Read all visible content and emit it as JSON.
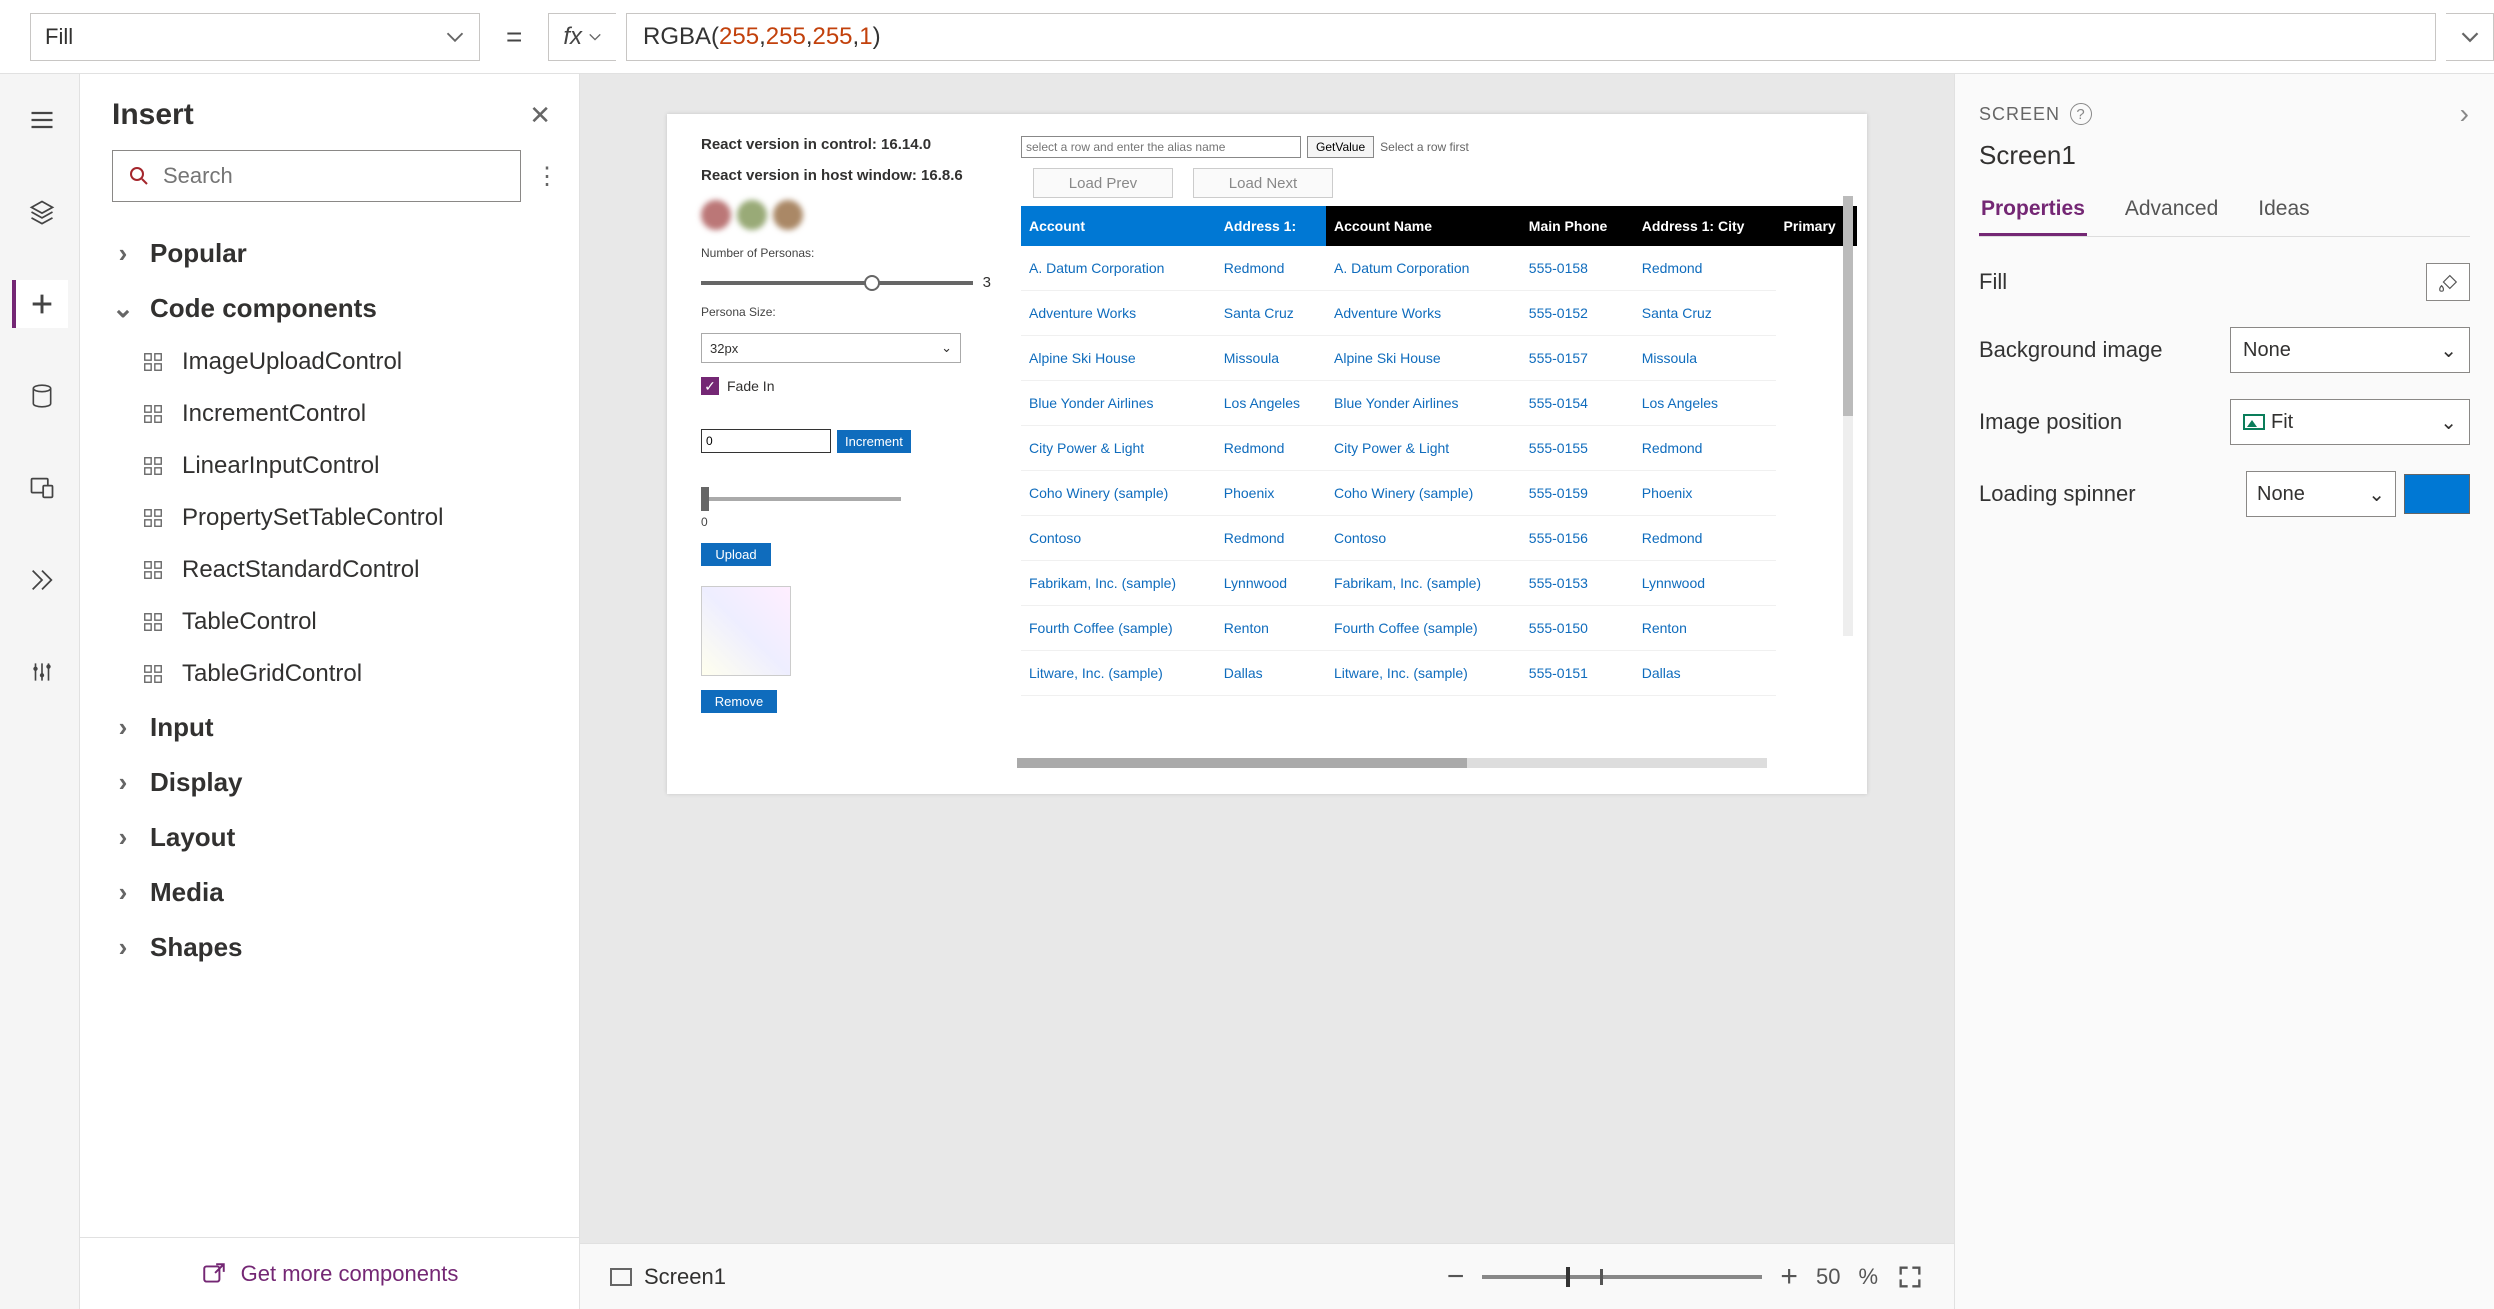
{
  "formula_bar": {
    "property": "Fill",
    "equals": "=",
    "fx_label": "fx",
    "formula_fn": "RGBA",
    "formula_args": [
      "255",
      "255",
      "255",
      "1"
    ]
  },
  "insert_panel": {
    "title": "Insert",
    "search_placeholder": "Search",
    "groups": {
      "popular": "Popular",
      "code_components": "Code components",
      "input": "Input",
      "display": "Display",
      "layout": "Layout",
      "media": "Media",
      "shapes": "Shapes"
    },
    "code_components_items": [
      "ImageUploadControl",
      "IncrementControl",
      "LinearInputControl",
      "PropertySetTableControl",
      "ReactStandardControl",
      "TableControl",
      "TableGridControl"
    ],
    "footer": "Get more components"
  },
  "canvas": {
    "left": {
      "react_control": "React version in control: 16.14.0",
      "react_host": "React version in host window: 16.8.6",
      "num_personas_label": "Number of Personas:",
      "num_personas_value": "3",
      "persona_size_label": "Persona Size:",
      "persona_size_value": "32px",
      "fade_in_label": "Fade In",
      "increment_value": "0",
      "increment_btn": "Increment",
      "plain_slider_value": "0",
      "upload_btn": "Upload",
      "remove_btn": "Remove"
    },
    "right": {
      "alias_placeholder": "select a row and enter the alias name",
      "getvalue_btn": "GetValue",
      "hint": "Select a row first",
      "load_prev": "Load Prev",
      "load_next": "Load Next",
      "headers": [
        "Account",
        "Address 1:",
        "Account Name",
        "Main Phone",
        "Address 1: City",
        "Primary"
      ],
      "rows": [
        [
          "A. Datum Corporation",
          "Redmond",
          "A. Datum Corporation",
          "555-0158",
          "Redmond"
        ],
        [
          "Adventure Works",
          "Santa Cruz",
          "Adventure Works",
          "555-0152",
          "Santa Cruz"
        ],
        [
          "Alpine Ski House",
          "Missoula",
          "Alpine Ski House",
          "555-0157",
          "Missoula"
        ],
        [
          "Blue Yonder Airlines",
          "Los Angeles",
          "Blue Yonder Airlines",
          "555-0154",
          "Los Angeles"
        ],
        [
          "City Power & Light",
          "Redmond",
          "City Power & Light",
          "555-0155",
          "Redmond"
        ],
        [
          "Coho Winery (sample)",
          "Phoenix",
          "Coho Winery (sample)",
          "555-0159",
          "Phoenix"
        ],
        [
          "Contoso",
          "Redmond",
          "Contoso",
          "555-0156",
          "Redmond"
        ],
        [
          "Fabrikam, Inc. (sample)",
          "Lynnwood",
          "Fabrikam, Inc. (sample)",
          "555-0153",
          "Lynnwood"
        ],
        [
          "Fourth Coffee (sample)",
          "Renton",
          "Fourth Coffee (sample)",
          "555-0150",
          "Renton"
        ],
        [
          "Litware, Inc. (sample)",
          "Dallas",
          "Litware, Inc. (sample)",
          "555-0151",
          "Dallas"
        ]
      ]
    }
  },
  "status_bar": {
    "screen_label": "Screen1",
    "zoom_pct": "50",
    "zoom_unit": "%"
  },
  "props": {
    "breadcrumb": "SCREEN",
    "name": "Screen1",
    "tabs": {
      "properties": "Properties",
      "advanced": "Advanced",
      "ideas": "Ideas"
    },
    "rows": {
      "fill": "Fill",
      "bg_image": "Background image",
      "bg_image_value": "None",
      "img_pos": "Image position",
      "img_pos_value": "Fit",
      "spinner": "Loading spinner",
      "spinner_value": "None"
    }
  }
}
